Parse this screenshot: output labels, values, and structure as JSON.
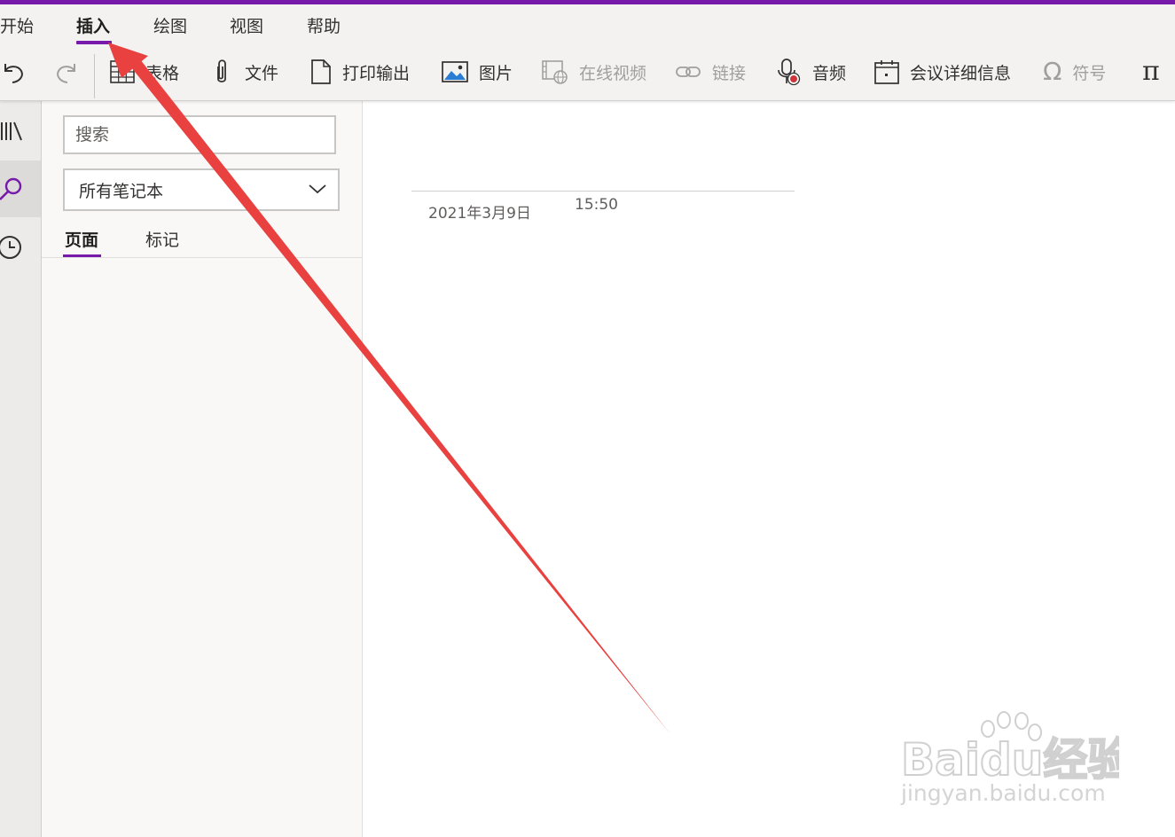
{
  "ribbon": {
    "tabs": [
      {
        "label": "开始"
      },
      {
        "label": "插入"
      },
      {
        "label": "绘图"
      },
      {
        "label": "视图"
      },
      {
        "label": "帮助"
      }
    ],
    "active_tab": "插入",
    "tools": [
      {
        "label": "表格",
        "icon": "table-icon"
      },
      {
        "label": "文件",
        "icon": "paperclip-icon"
      },
      {
        "label": "打印输出",
        "icon": "printout-icon"
      },
      {
        "label": "图片",
        "icon": "picture-icon"
      },
      {
        "label": "在线视频",
        "icon": "online-video-icon",
        "disabled": true
      },
      {
        "label": "链接",
        "icon": "link-icon",
        "disabled": true
      },
      {
        "label": "音频",
        "icon": "audio-icon"
      },
      {
        "label": "会议详细信息",
        "icon": "meeting-details-icon"
      },
      {
        "label": "符号",
        "icon": "omega-icon",
        "disabled": true
      }
    ]
  },
  "search_pane": {
    "search_placeholder": "搜索",
    "scope_value": "所有笔记本",
    "tabs": [
      {
        "label": "页面"
      },
      {
        "label": "标记"
      }
    ],
    "active_tab": "页面"
  },
  "page": {
    "date": "2021年3月9日",
    "time": "15:50"
  },
  "watermark": {
    "brand": "Baidu经验",
    "url": "jingyan.baidu.com"
  },
  "colors": {
    "accent": "#7719aa",
    "annotation_arrow": "#e8413f",
    "ribbon_bg": "#f3f2f1"
  }
}
